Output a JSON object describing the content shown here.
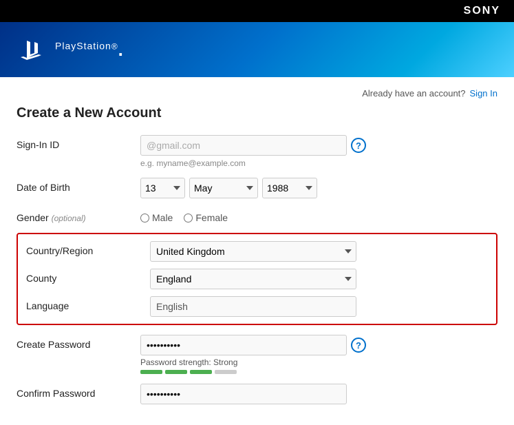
{
  "sony": {
    "brand": "SONY"
  },
  "header": {
    "ps_text": "PlayStation",
    "ps_sup": "®"
  },
  "top_bar": {
    "already_account": "Already have an account?",
    "sign_in": "Sign In"
  },
  "page": {
    "title": "Create a New Account"
  },
  "form": {
    "sign_in_id_label": "Sign-In ID",
    "sign_in_id_value": "@gmail.com",
    "sign_in_id_placeholder": "",
    "email_hint": "e.g. myname@example.com",
    "dob_label": "Date of Birth",
    "dob_day": "13",
    "dob_month": "May",
    "dob_year": "1988",
    "gender_label": "Gender",
    "gender_optional": "(optional)",
    "gender_male": "Male",
    "gender_female": "Female",
    "country_label": "Country/Region",
    "country_value": "United Kingdom",
    "county_label": "County",
    "county_value": "England",
    "language_label": "Language",
    "language_value": "English",
    "create_password_label": "Create Password",
    "password_value": "••••••••••",
    "password_strength_text": "Password strength: Strong",
    "confirm_password_label": "Confirm Password",
    "confirm_password_value": "••••••••••"
  },
  "icons": {
    "help": "?",
    "dropdown_arrow": "▼"
  }
}
